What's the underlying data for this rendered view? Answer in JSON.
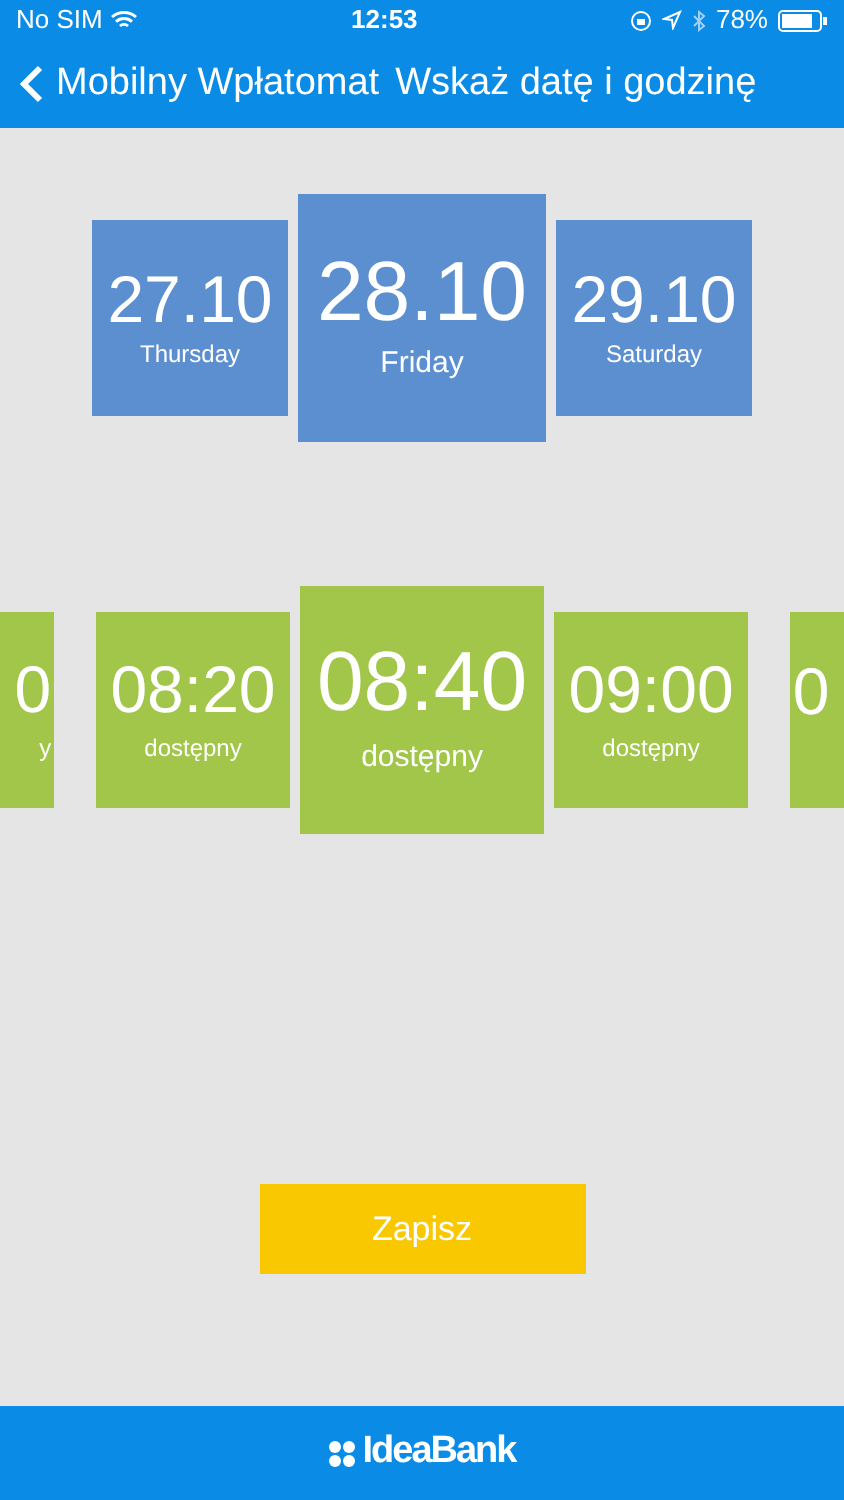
{
  "status_bar": {
    "carrier": "No SIM",
    "time": "12:53",
    "battery": "78%"
  },
  "nav": {
    "back_label": "Mobilny Wpłatomat",
    "title": "Wskaż datę i godzinę"
  },
  "dates": [
    {
      "date": "27.10",
      "day": "Thursday",
      "selected": false
    },
    {
      "date": "28.10",
      "day": "Friday",
      "selected": true
    },
    {
      "date": "29.10",
      "day": "Saturday",
      "selected": false
    }
  ],
  "slots": [
    {
      "kind": "cut_left",
      "time": "0",
      "status": "y",
      "selected": false
    },
    {
      "kind": "full",
      "time": "08:20",
      "status": "dostępny",
      "selected": false
    },
    {
      "kind": "full",
      "time": "08:40",
      "status": "dostępny",
      "selected": true
    },
    {
      "kind": "full",
      "time": "09:00",
      "status": "dostępny",
      "selected": false
    },
    {
      "kind": "cut_right",
      "time": "0",
      "selected": false
    }
  ],
  "save_button": "Zapisz",
  "footer": {
    "brand": "IdeaBank"
  }
}
